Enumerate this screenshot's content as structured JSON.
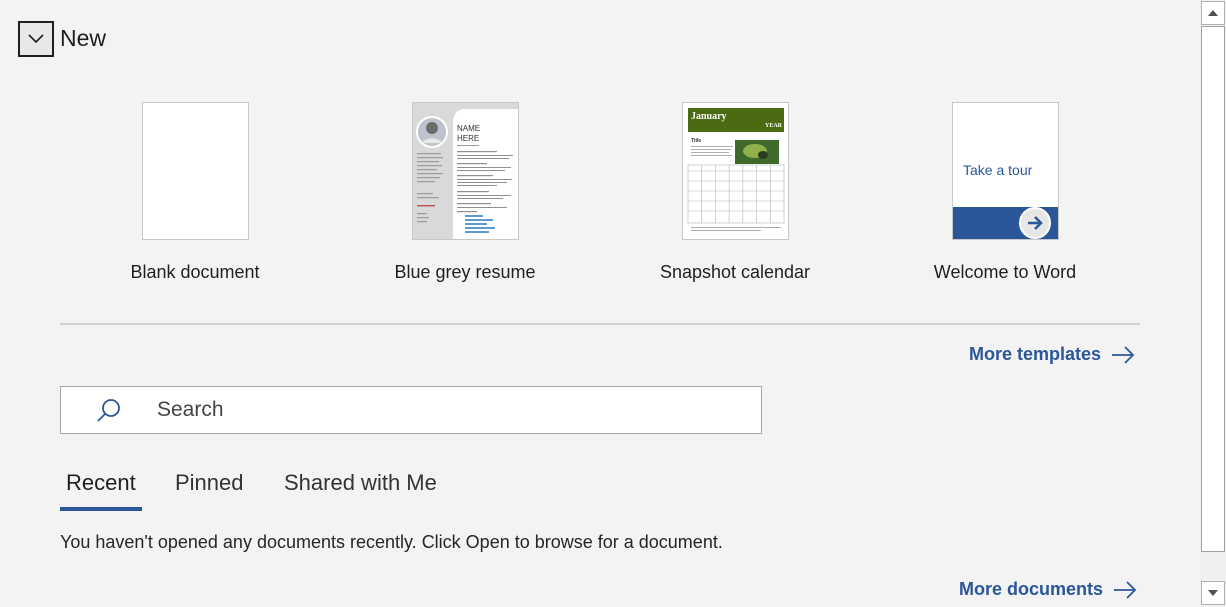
{
  "header": {
    "title": "New",
    "collapse_icon": "chevron-down-icon"
  },
  "templates": [
    {
      "label": "Blank document"
    },
    {
      "label": "Blue grey resume",
      "thumb_text": {
        "name_line1": "NAME",
        "name_line2": "HERE"
      }
    },
    {
      "label": "Snapshot calendar",
      "thumb_text": {
        "month": "January",
        "year": "YEAR",
        "title": "Title"
      }
    },
    {
      "label": "Welcome to Word",
      "thumb_text": {
        "tour": "Take a tour"
      }
    }
  ],
  "more_templates": {
    "label": "More templates",
    "icon": "arrow-right-icon"
  },
  "search": {
    "placeholder": "Search",
    "value": "",
    "icon": "search-icon"
  },
  "tabs": [
    {
      "label": "Recent",
      "active": true
    },
    {
      "label": "Pinned",
      "active": false
    },
    {
      "label": "Shared with Me",
      "active": false
    }
  ],
  "recent": {
    "empty_message": "You haven't opened any documents recently. Click Open to browse for a document."
  },
  "more_documents": {
    "label": "More documents",
    "icon": "arrow-right-icon"
  },
  "colors": {
    "accent": "#2b579a",
    "background": "#f3f3f3",
    "calendar_header": "#4a6b12"
  }
}
